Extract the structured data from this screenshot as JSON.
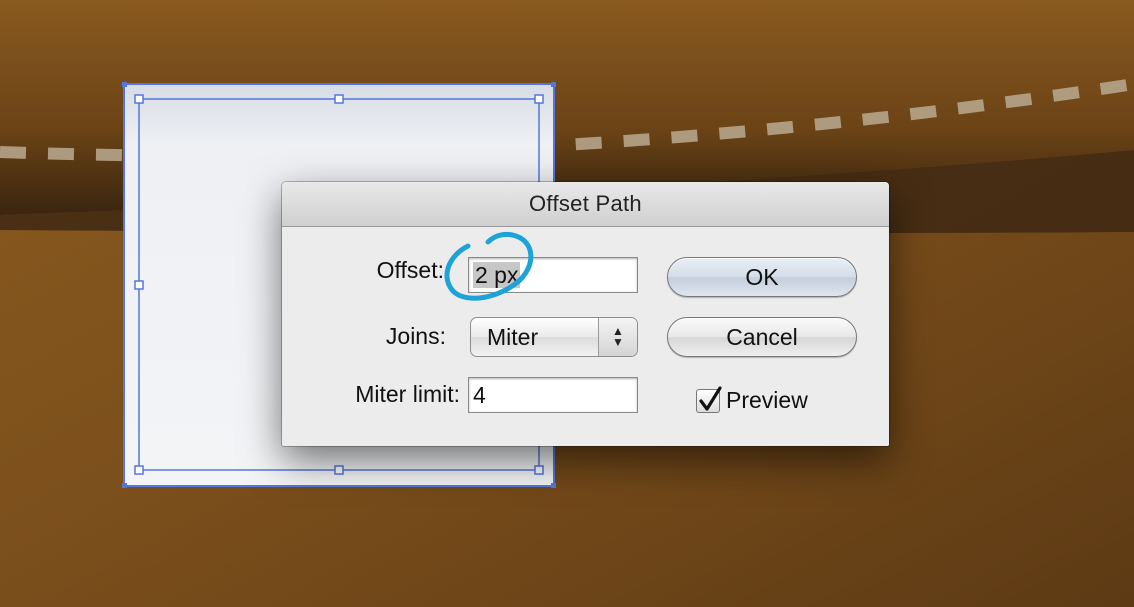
{
  "dialog": {
    "title": "Offset Path",
    "offset_label": "Offset:",
    "offset_value": "2 px",
    "joins_label": "Joins:",
    "joins_value": "Miter",
    "miter_limit_label": "Miter limit:",
    "miter_limit_value": "4",
    "ok_label": "OK",
    "cancel_label": "Cancel",
    "preview_label": "Preview",
    "preview_checked": true
  },
  "icons": {
    "select_arrows": "up-down-arrows-icon",
    "checkbox_check": "checkmark-icon",
    "annotation": "blue-circle-annotation"
  },
  "colors": {
    "background_brown": "#6e4418",
    "selection_blue": "#5577dd",
    "annotation_blue": "#1ea3d8",
    "stitch": "#b6a48a"
  }
}
